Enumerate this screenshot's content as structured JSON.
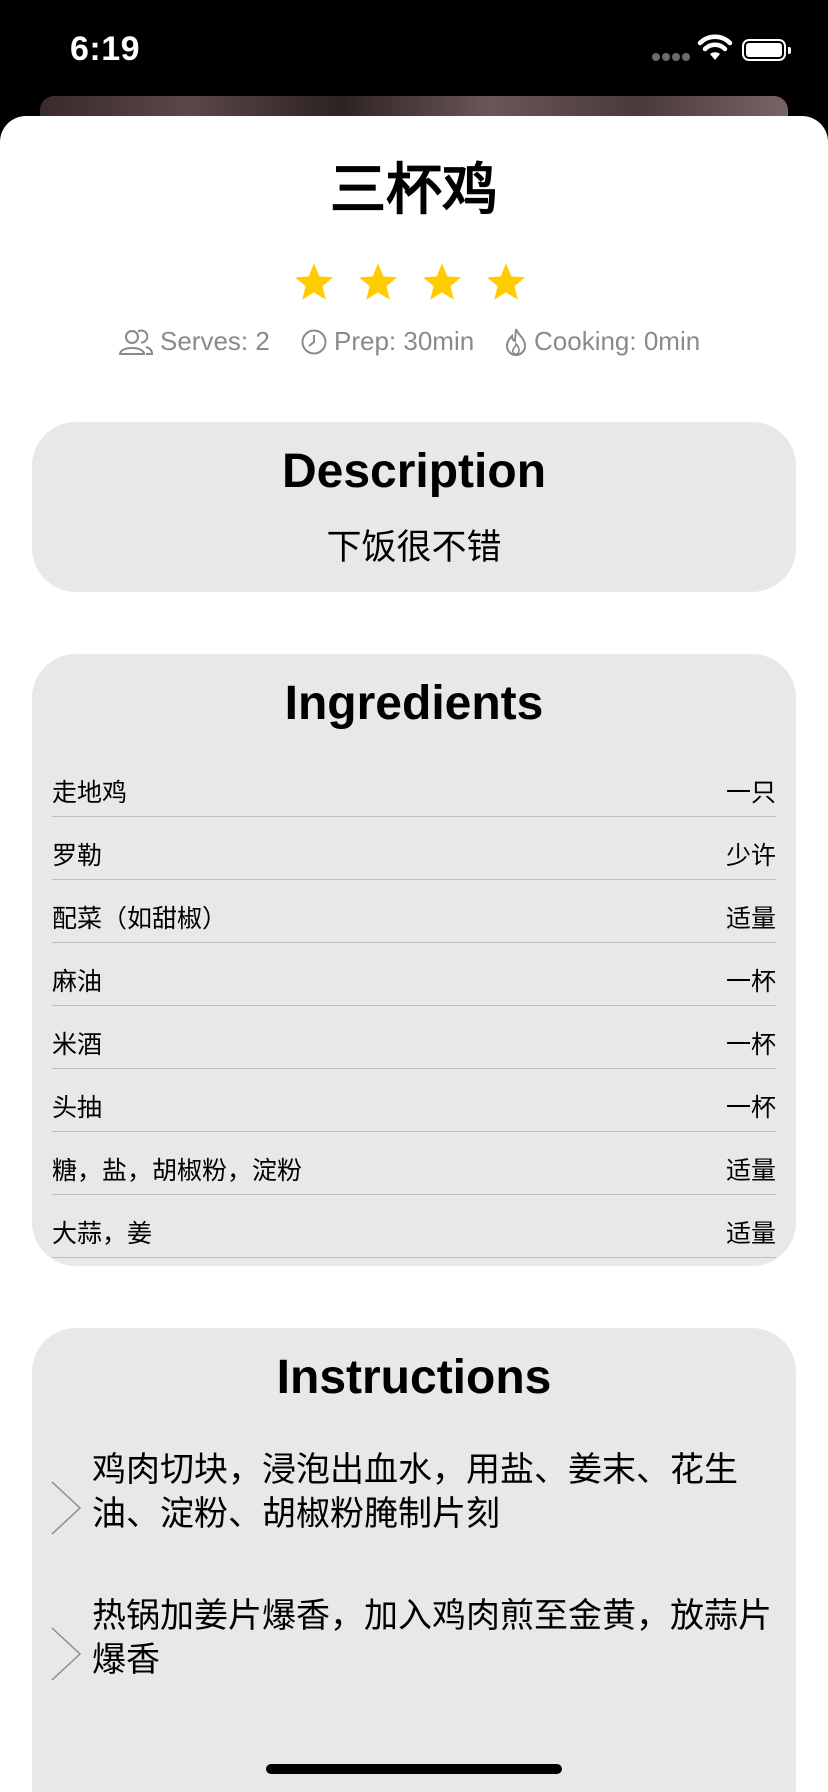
{
  "status_bar": {
    "time": "6:19"
  },
  "recipe": {
    "title": "三杯鸡",
    "rating": 4,
    "rating_max": 4,
    "meta": {
      "serves": "Serves: 2",
      "prep": "Prep: 30min",
      "cooking": "Cooking: 0min"
    },
    "description": {
      "heading": "Description",
      "text": "下饭很不错"
    },
    "ingredients": {
      "heading": "Ingredients",
      "items": [
        {
          "name": "走地鸡",
          "qty": "一只"
        },
        {
          "name": "罗勒",
          "qty": "少许"
        },
        {
          "name": "配菜（如甜椒）",
          "qty": "适量"
        },
        {
          "name": "麻油",
          "qty": "一杯"
        },
        {
          "name": "米酒",
          "qty": "一杯"
        },
        {
          "name": "头抽",
          "qty": "一杯"
        },
        {
          "name": "糖，盐，胡椒粉，淀粉",
          "qty": "适量"
        },
        {
          "name": "大蒜，姜",
          "qty": "适量"
        }
      ]
    },
    "instructions": {
      "heading": "Instructions",
      "steps": [
        "鸡肉切块，浸泡出血水，用盐、姜末、花生油、淀粉、胡椒粉腌制片刻",
        "热锅加姜片爆香，加入鸡肉煎至金黄，放蒜片爆香"
      ]
    }
  },
  "icons": {
    "star": "star-icon",
    "serves": "people-icon",
    "prep": "clock-icon",
    "cooking": "flame-icon",
    "step": "chevron-right-icon"
  },
  "colors": {
    "star": "#FFCC00",
    "card_bg": "#E8E8E8",
    "meta_text": "#8A8A8A"
  }
}
